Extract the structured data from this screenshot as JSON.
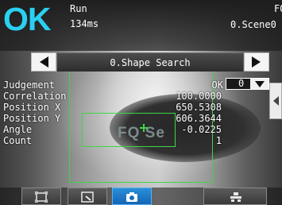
{
  "status": {
    "judgement_big": "OK",
    "mode": "Run",
    "processing_time": "134ms",
    "device_label": "FQ",
    "scene": "0.Scene0"
  },
  "tool": {
    "name": "0.Shape Search"
  },
  "image_text": "FQ Se",
  "results": [
    {
      "label": "Judgement",
      "value": "OK"
    },
    {
      "label": "Correlation",
      "value": "100.0000"
    },
    {
      "label": "Position X",
      "value": "650.5308"
    },
    {
      "label": "Position Y",
      "value": "606.3644"
    },
    {
      "label": "Angle",
      "value": "-0.0225"
    },
    {
      "label": "Count",
      "value": "1"
    }
  ],
  "display_index": "0",
  "colors": {
    "ok": "#2ad0f2",
    "region": "#3dd64a",
    "active_button": "#1e7ac8"
  },
  "icons": {
    "prev": "left-triangle-icon",
    "next": "right-triangle-icon",
    "dropdown": "down-triangle-icon",
    "side_tab": "left-triangle-icon",
    "toolbar": [
      "fit-frame-icon",
      "zoom-icon",
      "camera-icon",
      "settings-icon"
    ]
  }
}
